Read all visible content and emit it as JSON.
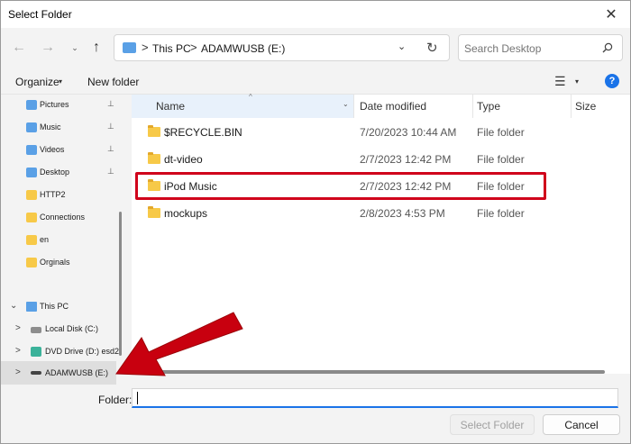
{
  "window": {
    "title": "Select Folder",
    "close_glyph": "✕"
  },
  "navigation": {
    "back_glyph": "←",
    "forward_glyph": "→",
    "down_glyph": "⌄",
    "up_glyph": "↑"
  },
  "address": {
    "crumbs": [
      "This PC",
      "ADAMWUSB (E:)"
    ],
    "separator": ">",
    "dropdown_glyph": "⌄",
    "refresh_glyph": "↻"
  },
  "search": {
    "placeholder": "Search Desktop"
  },
  "toolbar": {
    "organize_label": "Organize",
    "new_folder_label": "New folder",
    "view_glyph": "☰",
    "caret_glyph": "▾",
    "help_label": "?"
  },
  "nav_pane": {
    "items": [
      {
        "label": "Pictures",
        "icon": "pictures-icon",
        "pinned": true
      },
      {
        "label": "Music",
        "icon": "music-icon",
        "pinned": true
      },
      {
        "label": "Videos",
        "icon": "videos-icon",
        "pinned": true
      },
      {
        "label": "Desktop",
        "icon": "desktop-icon",
        "pinned": true
      },
      {
        "label": "HTTP2",
        "icon": "folder-icon",
        "pinned": false
      },
      {
        "label": "Connections",
        "icon": "folder-icon",
        "pinned": false
      },
      {
        "label": "en",
        "icon": "folder-icon",
        "pinned": false
      },
      {
        "label": "Orginals",
        "icon": "folder-icon",
        "pinned": false
      },
      {
        "label": "This PC",
        "icon": "pc-icon",
        "expanded": true
      },
      {
        "label": "Local Disk (C:)",
        "icon": "drive-icon",
        "expanded": false
      },
      {
        "label": "DVD Drive (D:) esd2",
        "icon": "dvd-icon",
        "expanded": false
      },
      {
        "label": "ADAMWUSB (E:)",
        "icon": "usb-drive-icon",
        "expanded": false,
        "selected": true
      }
    ],
    "pin_glyph": "📌",
    "expand_glyph": ">",
    "collapse_glyph": "⌄"
  },
  "file_list": {
    "columns": {
      "name": "Name",
      "date": "Date modified",
      "type": "Type",
      "size": "Size",
      "sort_glyph": "^",
      "caret_glyph": "⌄"
    },
    "rows": [
      {
        "name": "$RECYCLE.BIN",
        "date": "7/20/2023 10:44 AM",
        "type": "File folder"
      },
      {
        "name": "dt-video",
        "date": "2/7/2023 12:42 PM",
        "type": "File folder"
      },
      {
        "name": "iPod Music",
        "date": "2/7/2023 12:42 PM",
        "type": "File folder",
        "highlighted": true
      },
      {
        "name": "mockups",
        "date": "2/8/2023 4:53 PM",
        "type": "File folder"
      }
    ]
  },
  "footer": {
    "folder_label": "Folder:",
    "folder_value": "",
    "select_label": "Select Folder",
    "cancel_label": "Cancel"
  },
  "colors": {
    "highlight_box": "#d0021b",
    "arrow": "#c8000f",
    "folder": "#f7c948",
    "accent": "#1a73e8"
  }
}
